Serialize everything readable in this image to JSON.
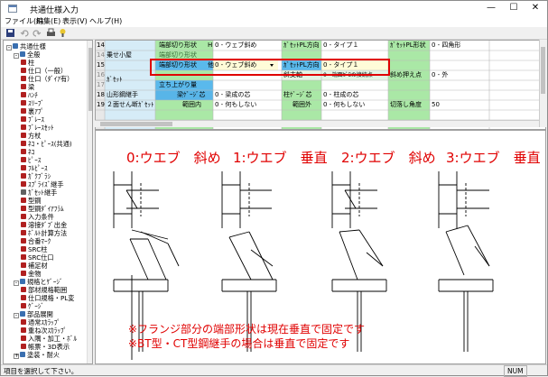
{
  "window": {
    "title": "共通仕様入力",
    "minimize": "—",
    "maximize": "☐",
    "close": "✕"
  },
  "menu": [
    "ファイル(F)",
    "編集(E)",
    "表示(V)",
    "ヘルプ(H)"
  ],
  "toolbar": [
    "save-icon",
    "undo-icon",
    "redo-icon",
    "print-icon",
    "help-icon"
  ],
  "tree": [
    {
      "label": "共通仕様",
      "level": 0,
      "expand": "-",
      "color": "#3a6fb0"
    },
    {
      "label": "全般",
      "level": 1,
      "expand": "-",
      "color": "#3a6fb0"
    },
    {
      "label": "柱",
      "level": 2,
      "color": "#b02020"
    },
    {
      "label": "仕口（一般）",
      "level": 2,
      "color": "#b02020"
    },
    {
      "label": "仕口（ﾀﾞｲｱ有）",
      "level": 2,
      "color": "#b02020"
    },
    {
      "label": "梁",
      "level": 2,
      "color": "#b02020"
    },
    {
      "label": "ﾊﾝﾁ",
      "level": 2,
      "color": "#b02020"
    },
    {
      "label": "ｽﾘｰﾌﾞ",
      "level": 2,
      "color": "#b02020"
    },
    {
      "label": "裏ｱﾌﾟ",
      "level": 2,
      "color": "#b02020"
    },
    {
      "label": "ﾌﾞﾚｰｽ",
      "level": 2,
      "color": "#b02020"
    },
    {
      "label": "ﾌﾞﾚｰｽｾｯﾄ",
      "level": 2,
      "color": "#b02020"
    },
    {
      "label": "方杖",
      "level": 2,
      "color": "#b02020"
    },
    {
      "label": "ﾈｺ・ﾋﾟｰｽ(共通)",
      "level": 2,
      "color": "#b02020"
    },
    {
      "label": "ﾈｺ",
      "level": 2,
      "color": "#b02020"
    },
    {
      "label": "ﾋﾟｰｽ",
      "level": 2,
      "color": "#b02020"
    },
    {
      "label": "ﾌﾙﾋﾟｰｽ",
      "level": 2,
      "color": "#b02020"
    },
    {
      "label": "ｶﾞｸﾌﾞﾗｼ",
      "level": 2,
      "color": "#b02020"
    },
    {
      "label": "ｽﾌﾟﾗｲｽﾞ継手",
      "level": 2,
      "color": "#b02020"
    },
    {
      "label": "ｶﾞｾｯﾄ継手",
      "level": 2,
      "color": "#606060"
    },
    {
      "label": "型鋼",
      "level": 2,
      "color": "#b02020"
    },
    {
      "label": "型鋼ﾀﾞｲｱﾌﾗﾑ",
      "level": 2,
      "color": "#b02020"
    },
    {
      "label": "入力条件",
      "level": 2,
      "color": "#b02020"
    },
    {
      "label": "溶接ﾀﾞﾌﾞ出金",
      "level": 2,
      "color": "#b02020"
    },
    {
      "label": "ﾎﾞﾙﾄ計算方法",
      "level": 2,
      "color": "#b02020"
    },
    {
      "label": "合番ﾏｰｸ",
      "level": 2,
      "color": "#b02020"
    },
    {
      "label": "SRC柱",
      "level": 2,
      "color": "#b02020"
    },
    {
      "label": "SRC仕口",
      "level": 2,
      "color": "#b02020"
    },
    {
      "label": "補足材",
      "level": 2,
      "color": "#b02020"
    },
    {
      "label": "金物",
      "level": 2,
      "color": "#b02020"
    },
    {
      "label": "規格とｹﾞｰｼﾞ",
      "level": 1,
      "expand": "-",
      "color": "#3a6fb0"
    },
    {
      "label": "部材規格範囲",
      "level": 2,
      "color": "#b02020"
    },
    {
      "label": "仕口規格・PL変",
      "level": 2,
      "color": "#b02020"
    },
    {
      "label": "ｹﾞｰｼﾞ",
      "level": 2,
      "color": "#b02020"
    },
    {
      "label": "部品展開",
      "level": 1,
      "expand": "-",
      "color": "#3a6fb0"
    },
    {
      "label": "通常ｽｶﾗｯﾌﾟ",
      "level": 2,
      "color": "#b02020"
    },
    {
      "label": "重ね次ｽｶﾗｯﾌﾟ",
      "level": 2,
      "color": "#b02020"
    },
    {
      "label": "入隅・加工・ﾎﾞﾙ",
      "level": 2,
      "color": "#b02020"
    },
    {
      "label": "帳票・3D表示",
      "level": 2,
      "color": "#b02020"
    },
    {
      "label": "塗装・耐火",
      "level": 1,
      "expand": "+",
      "color": "#3a6fb0"
    }
  ],
  "grid": {
    "rows": [
      {
        "num": "14",
        "cells": [
          "端部切り形状",
          "H",
          "0 - ウェブ斜め",
          "ｶﾞｾｯﾄPL方向",
          "0 - タイプ１",
          "ｶﾞｾｯﾄPL形状",
          "0 - 四角形"
        ]
      },
      {
        "num": "15",
        "cells": [
          "端部切り形状",
          "他",
          "0 - ウェブ斜め",
          "ｶﾞｾｯﾄPL方向",
          "0 - タイプ１",
          "",
          ""
        ]
      },
      {
        "num": "16",
        "cells": [
          "",
          "",
          "",
          "斜支軸",
          "0 - 端面ｾﾞﾛの接続点",
          "斜め押え点",
          "0 - 外"
        ]
      },
      {
        "num": "17",
        "cells": [
          "立ち上がり量",
          "",
          "",
          "",
          "",
          "",
          ""
        ]
      },
      {
        "num": "18",
        "cells": [
          "梁ｹﾞｰｼﾞ芯",
          "",
          "0 - 梁成の芯",
          "柱ｹﾞｰｼﾞ芯",
          "0 - 柱成の芯",
          "",
          ""
        ]
      },
      {
        "num": "19",
        "cells": [
          "範囲内",
          "",
          "0 - 何もしない",
          "範囲外",
          "0 - 何もしない",
          "切落し角度",
          "50"
        ]
      }
    ],
    "groups": [
      "乗せ小屋",
      "ｶﾞｾｯﾄ",
      "山形鋼継手",
      "２面せん断ｶﾞｾｯﾄ"
    ],
    "hidden_label": "端部切り形状"
  },
  "preview": {
    "labels": [
      "0:ウエブ　斜め",
      "1:ウエブ　垂直",
      "2:ウエブ　斜め",
      "3:ウエブ　垂直"
    ],
    "notes": [
      "※フランジ部分の端部形状は現在垂直で固定です",
      "※BT型・CT型鋼継手の場合は垂直で固定です"
    ]
  },
  "status": {
    "text": "項目を選択して下さい。",
    "num": "NUM"
  }
}
